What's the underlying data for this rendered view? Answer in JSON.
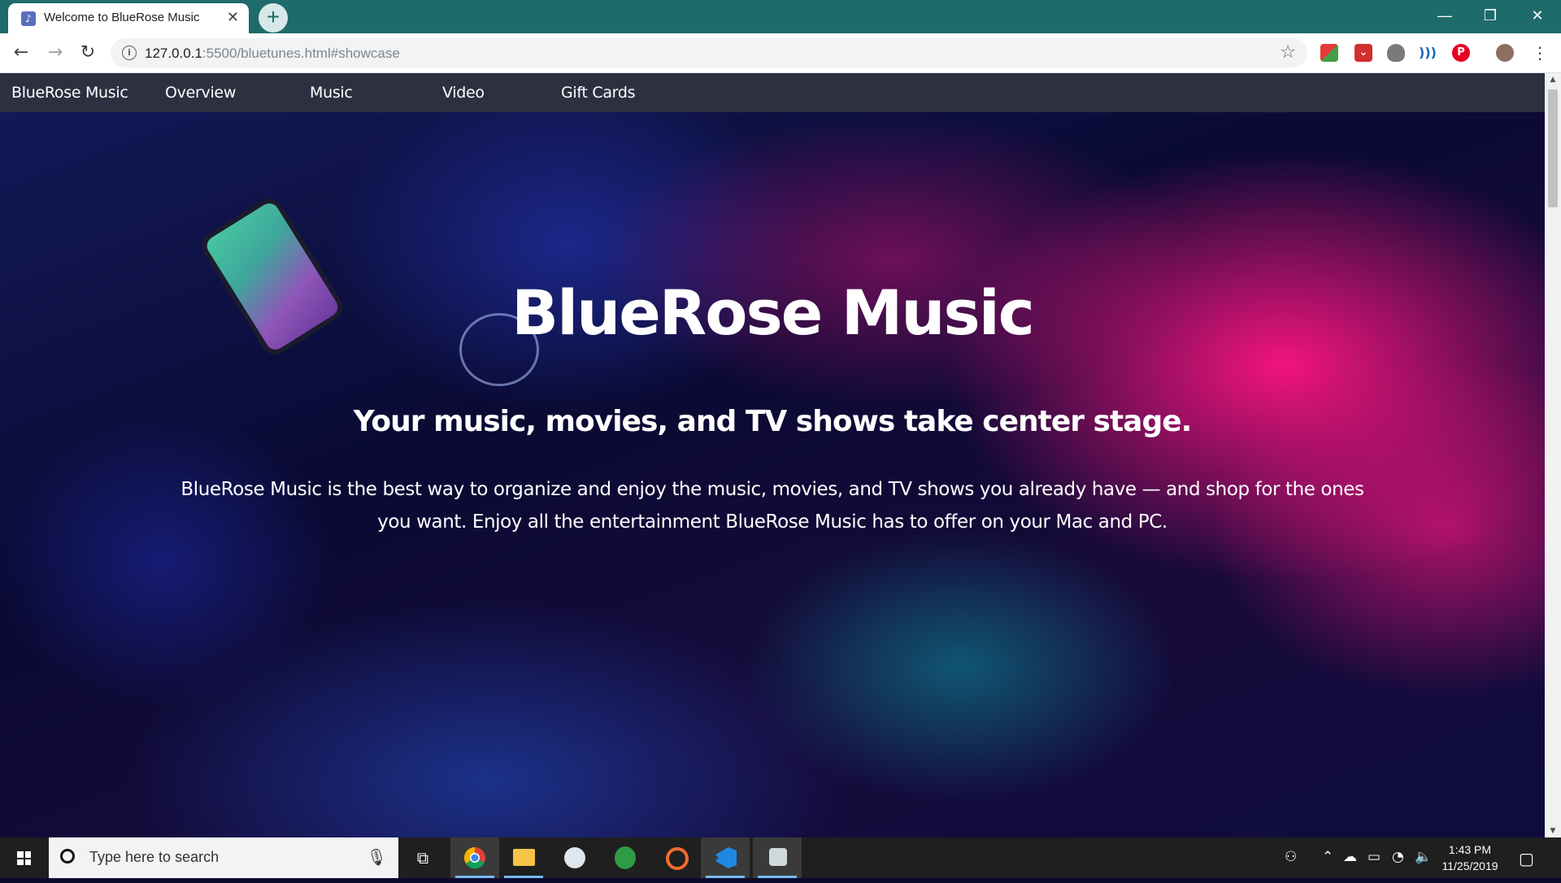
{
  "browser": {
    "tab_title": "Welcome to BlueRose Music",
    "tab_close": "✕",
    "new_tab": "+",
    "window_controls": {
      "minimize": "—",
      "restore": "❐",
      "close": "✕"
    },
    "url_host": "127.0.0.1",
    "url_rest": ":5500/bluetunes.html#showcase",
    "colors": {
      "titlebar": "#1d6b6a"
    }
  },
  "site": {
    "brand": "BlueRose Music",
    "nav": [
      "Overview",
      "Music",
      "Video",
      "Gift Cards"
    ],
    "hero": {
      "title": "BlueRose Music",
      "subtitle": "Your music, movies, and TV shows take center stage.",
      "body": "BlueRose Music is the best way to organize and enjoy the music, movies, and TV shows you already have — and shop for the ones you want. Enjoy all the entertainment BlueRose Music has to offer on your Mac and PC."
    }
  },
  "taskbar": {
    "search_placeholder": "Type here to search",
    "apps": [
      "task-view",
      "chrome",
      "file-explorer",
      "steam",
      "sims",
      "origin",
      "vscode",
      "dev-app"
    ],
    "clock_time": "1:43 PM",
    "clock_date": "11/25/2019"
  }
}
